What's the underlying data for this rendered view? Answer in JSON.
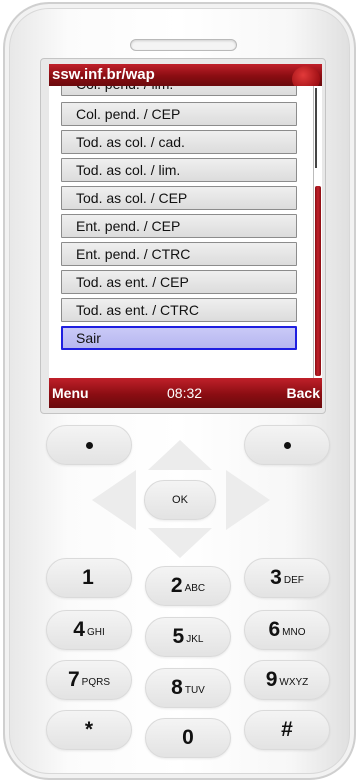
{
  "title_bar": {
    "url": "ssw.inf.br/wap"
  },
  "menu": {
    "items": [
      {
        "label": "Col. pend. / lim."
      },
      {
        "label": "Col. pend. / CEP"
      },
      {
        "label": "Tod. as col. / cad."
      },
      {
        "label": "Tod. as col. / lim."
      },
      {
        "label": "Tod. as col. / CEP"
      },
      {
        "label": "Ent. pend. / CEP"
      },
      {
        "label": "Ent. pend. / CTRC"
      },
      {
        "label": "Tod. as ent. / CEP"
      },
      {
        "label": "Tod. as ent. / CTRC"
      },
      {
        "label": "Sair"
      }
    ],
    "selected_index": 9
  },
  "softkeys": {
    "left": "Menu",
    "time": "08:32",
    "right": "Back"
  },
  "keypad": {
    "ok_label": "OK",
    "keys": [
      {
        "num": "1",
        "letters": ""
      },
      {
        "num": "2",
        "letters": "ABC"
      },
      {
        "num": "3",
        "letters": "DEF"
      },
      {
        "num": "4",
        "letters": "GHI"
      },
      {
        "num": "5",
        "letters": "JKL"
      },
      {
        "num": "6",
        "letters": "MNO"
      },
      {
        "num": "7",
        "letters": "PQRS"
      },
      {
        "num": "8",
        "letters": "TUV"
      },
      {
        "num": "9",
        "letters": "WXYZ"
      },
      {
        "num": "*",
        "letters": ""
      },
      {
        "num": "0",
        "letters": ""
      },
      {
        "num": "#",
        "letters": ""
      }
    ]
  },
  "colors": {
    "accent": "#8a0d12",
    "selection_border": "#1f1fe0",
    "selection_fill": "#c0c0f4"
  }
}
